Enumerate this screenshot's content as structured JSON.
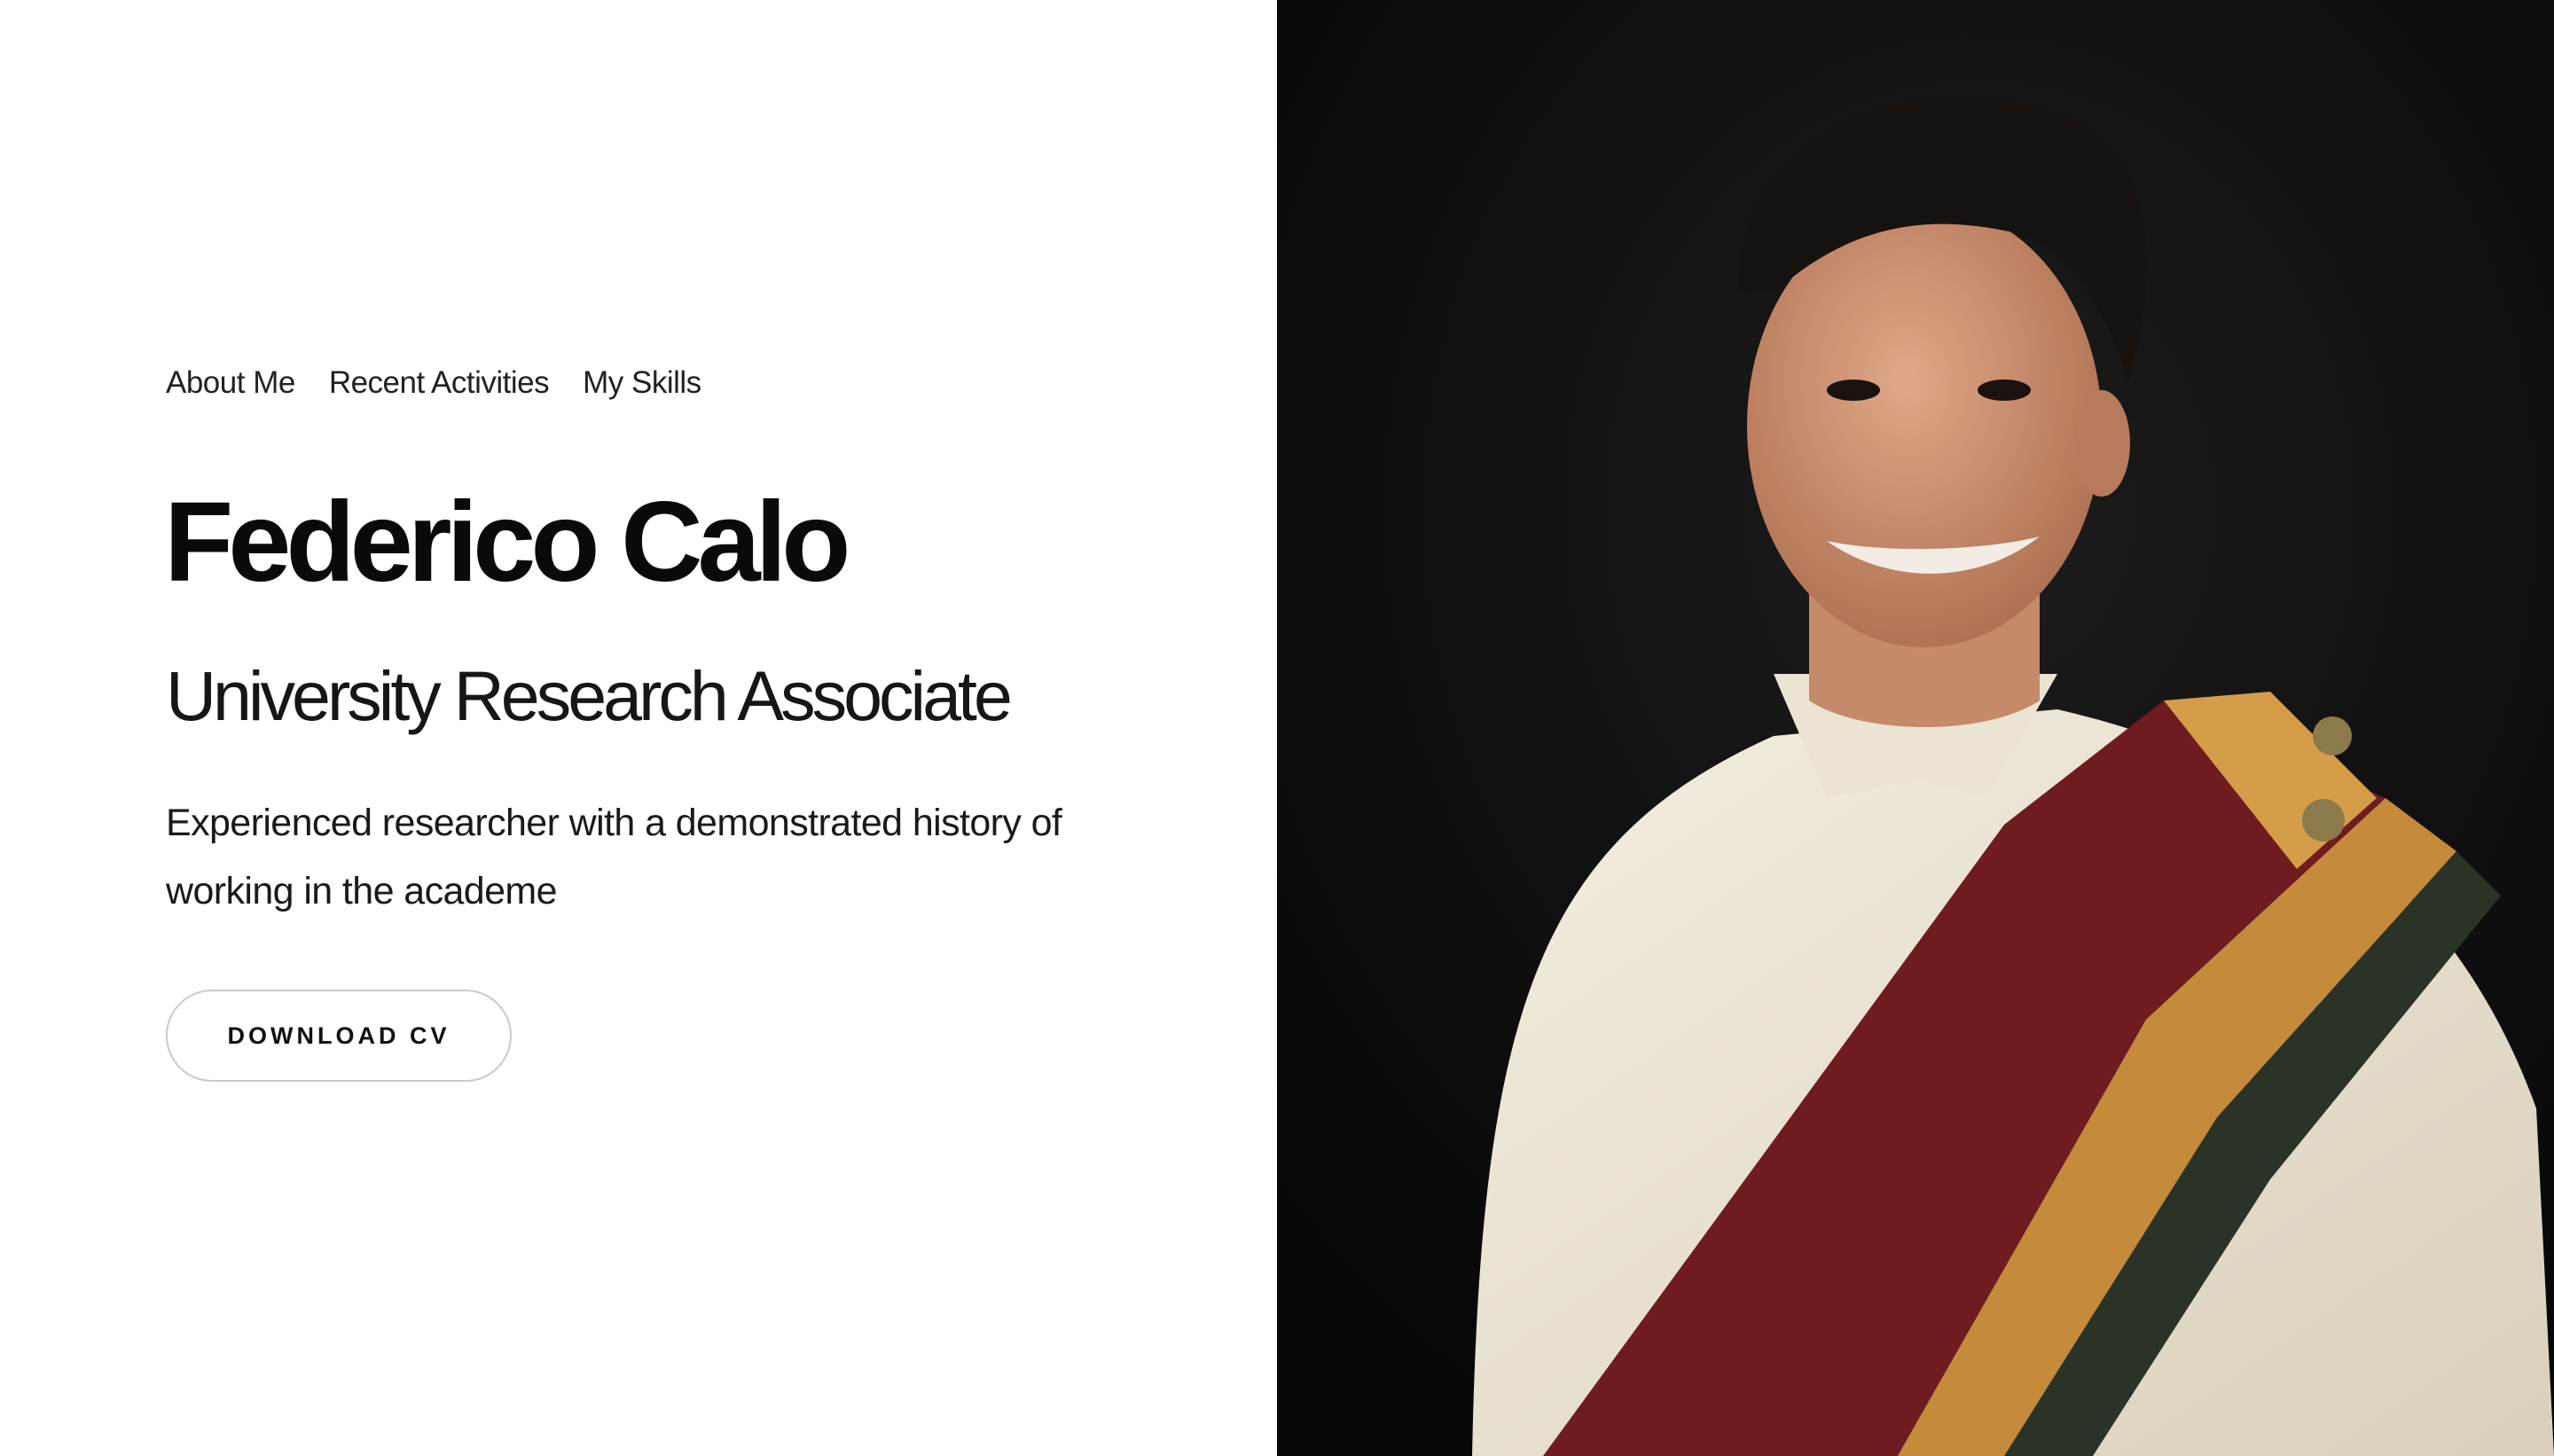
{
  "nav": {
    "items": [
      "About Me",
      "Recent Activities",
      "My Skills"
    ]
  },
  "hero": {
    "name": "Federico Calo",
    "title": "University Research Associate",
    "description": "Experienced researcher with a demonstrated history of working in the academe",
    "cta_label": "DOWNLOAD CV"
  },
  "colors": {
    "background": "#ffffff",
    "photo_background": "#0b0b0b",
    "text": "#111111",
    "button_border": "#c9c9c9"
  },
  "portrait": {
    "icon": "portrait-photo"
  }
}
